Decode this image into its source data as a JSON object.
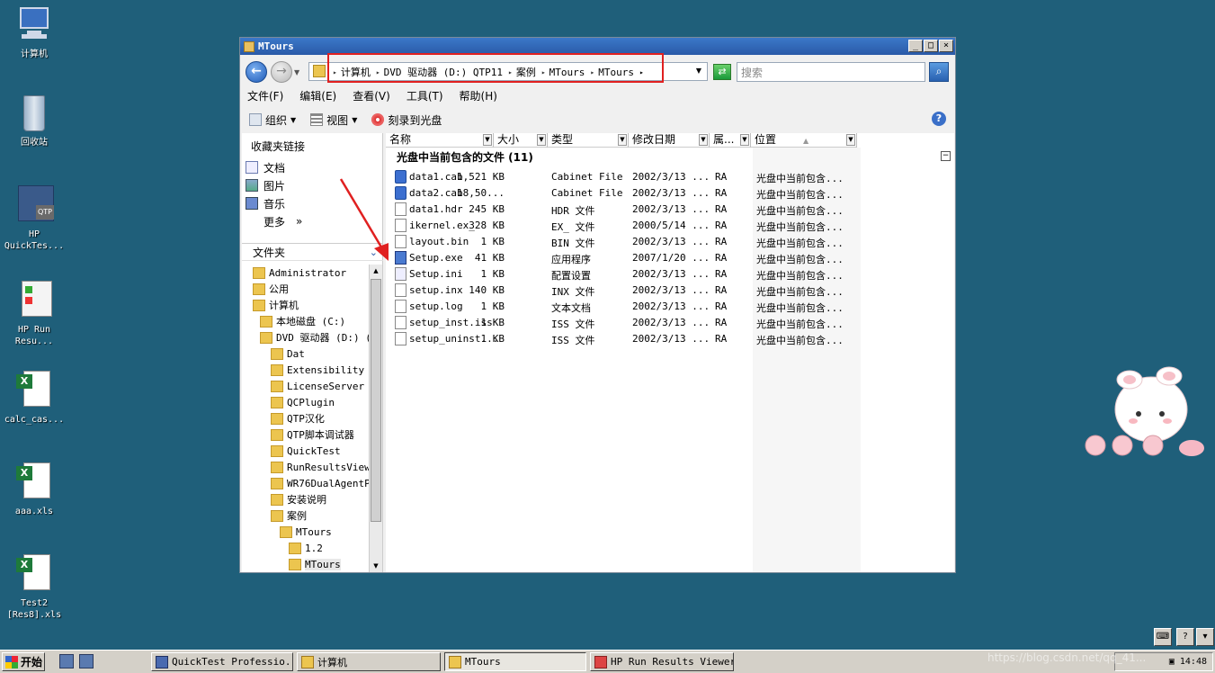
{
  "desktop": {
    "icons": [
      {
        "label": "计算机",
        "icon": "computer-icon"
      },
      {
        "label": "回收站",
        "icon": "recycle-bin-icon"
      },
      {
        "label": "HP QuickTes...",
        "icon": "quicktest-icon"
      },
      {
        "label": "HP Run Resu...",
        "icon": "run-results-icon"
      },
      {
        "label": "calc_cas...",
        "icon": "excel-file-icon"
      },
      {
        "label": "aaa.xls",
        "icon": "excel-file-icon"
      },
      {
        "label": "Test2 [Res8].xls",
        "icon": "excel-file-icon"
      }
    ]
  },
  "window": {
    "title": "MTours",
    "min_label": "_",
    "max_label": "□",
    "close_label": "×"
  },
  "address": {
    "crumbs": [
      "计算机",
      "DVD 驱动器 (D:) QTP11",
      "案例",
      "MTours",
      "MTours"
    ],
    "search_placeholder": "搜索"
  },
  "menu": [
    "文件(F)",
    "编辑(E)",
    "查看(V)",
    "工具(T)",
    "帮助(H)"
  ],
  "toolbar": {
    "organize": "组织",
    "views": "视图",
    "burn": "刻录到光盘"
  },
  "favorites": {
    "header": "收藏夹链接",
    "items": [
      "文档",
      "图片",
      "音乐"
    ],
    "more": "更多",
    "more_arrow": "»"
  },
  "folders": {
    "header": "文件夹",
    "nodes": [
      "Administrator",
      "公用",
      "计算机",
      "本地磁盘 (C:)",
      "DVD 驱动器 (D:) (",
      "Dat",
      "Extensibility a",
      "LicenseServer",
      "QCPlugin",
      "QTP汉化",
      "QTP脚本调试器",
      "QuickTest",
      "RunResultsViewe",
      "WR76DualAgentPa",
      "安装说明",
      "案例",
      "MTours",
      "1.2",
      "MTours"
    ]
  },
  "columns": [
    "名称",
    "大小",
    "类型",
    "修改日期",
    "属...",
    "位置"
  ],
  "group_label": "光盘中当前包含的文件 (11)",
  "files": [
    {
      "name": "data1.cab",
      "size": "1,521 KB",
      "type": "Cabinet File",
      "date": "2002/3/13 ...",
      "attr": "RA",
      "loc": "光盘中当前包含...",
      "kind": "cab"
    },
    {
      "name": "data2.cab",
      "size": "18,50...",
      "type": "Cabinet File",
      "date": "2002/3/13 ...",
      "attr": "RA",
      "loc": "光盘中当前包含...",
      "kind": "cab"
    },
    {
      "name": "data1.hdr",
      "size": "245 KB",
      "type": "HDR 文件",
      "date": "2002/3/13 ...",
      "attr": "RA",
      "loc": "光盘中当前包含...",
      "kind": "doc"
    },
    {
      "name": "ikernel.ex_",
      "size": "328 KB",
      "type": "EX_ 文件",
      "date": "2000/5/14 ...",
      "attr": "RA",
      "loc": "光盘中当前包含...",
      "kind": "doc"
    },
    {
      "name": "layout.bin",
      "size": "1 KB",
      "type": "BIN 文件",
      "date": "2002/3/13 ...",
      "attr": "RA",
      "loc": "光盘中当前包含...",
      "kind": "doc"
    },
    {
      "name": "Setup.exe",
      "size": "41 KB",
      "type": "应用程序",
      "date": "2007/1/20 ...",
      "attr": "RA",
      "loc": "光盘中当前包含...",
      "kind": "exe"
    },
    {
      "name": "Setup.ini",
      "size": "1 KB",
      "type": "配置设置",
      "date": "2002/3/13 ...",
      "attr": "RA",
      "loc": "光盘中当前包含...",
      "kind": "ini"
    },
    {
      "name": "setup.inx",
      "size": "140 KB",
      "type": "INX 文件",
      "date": "2002/3/13 ...",
      "attr": "RA",
      "loc": "光盘中当前包含...",
      "kind": "doc"
    },
    {
      "name": "setup.log",
      "size": "1 KB",
      "type": "文本文档",
      "date": "2002/3/13 ...",
      "attr": "RA",
      "loc": "光盘中当前包含...",
      "kind": "doc"
    },
    {
      "name": "setup_inst.iss",
      "size": "1 KB",
      "type": "ISS 文件",
      "date": "2002/3/13 ...",
      "attr": "RA",
      "loc": "光盘中当前包含...",
      "kind": "doc"
    },
    {
      "name": "setup_uninst...",
      "size": "1 KB",
      "type": "ISS 文件",
      "date": "2002/3/13 ...",
      "attr": "RA",
      "loc": "光盘中当前包含...",
      "kind": "doc"
    }
  ],
  "taskbar": {
    "start": "开始",
    "tasks": [
      "QuickTest Professio...",
      "计算机",
      "MTours",
      "HP Run Results Viewer"
    ],
    "clock": "14:48",
    "watermark": "https://blog.csdn.net/qq_41..."
  },
  "colors": {
    "desktop": "#1f5f7a",
    "titlebar": "#2a5aa8",
    "highlight_box": "#e02020"
  }
}
